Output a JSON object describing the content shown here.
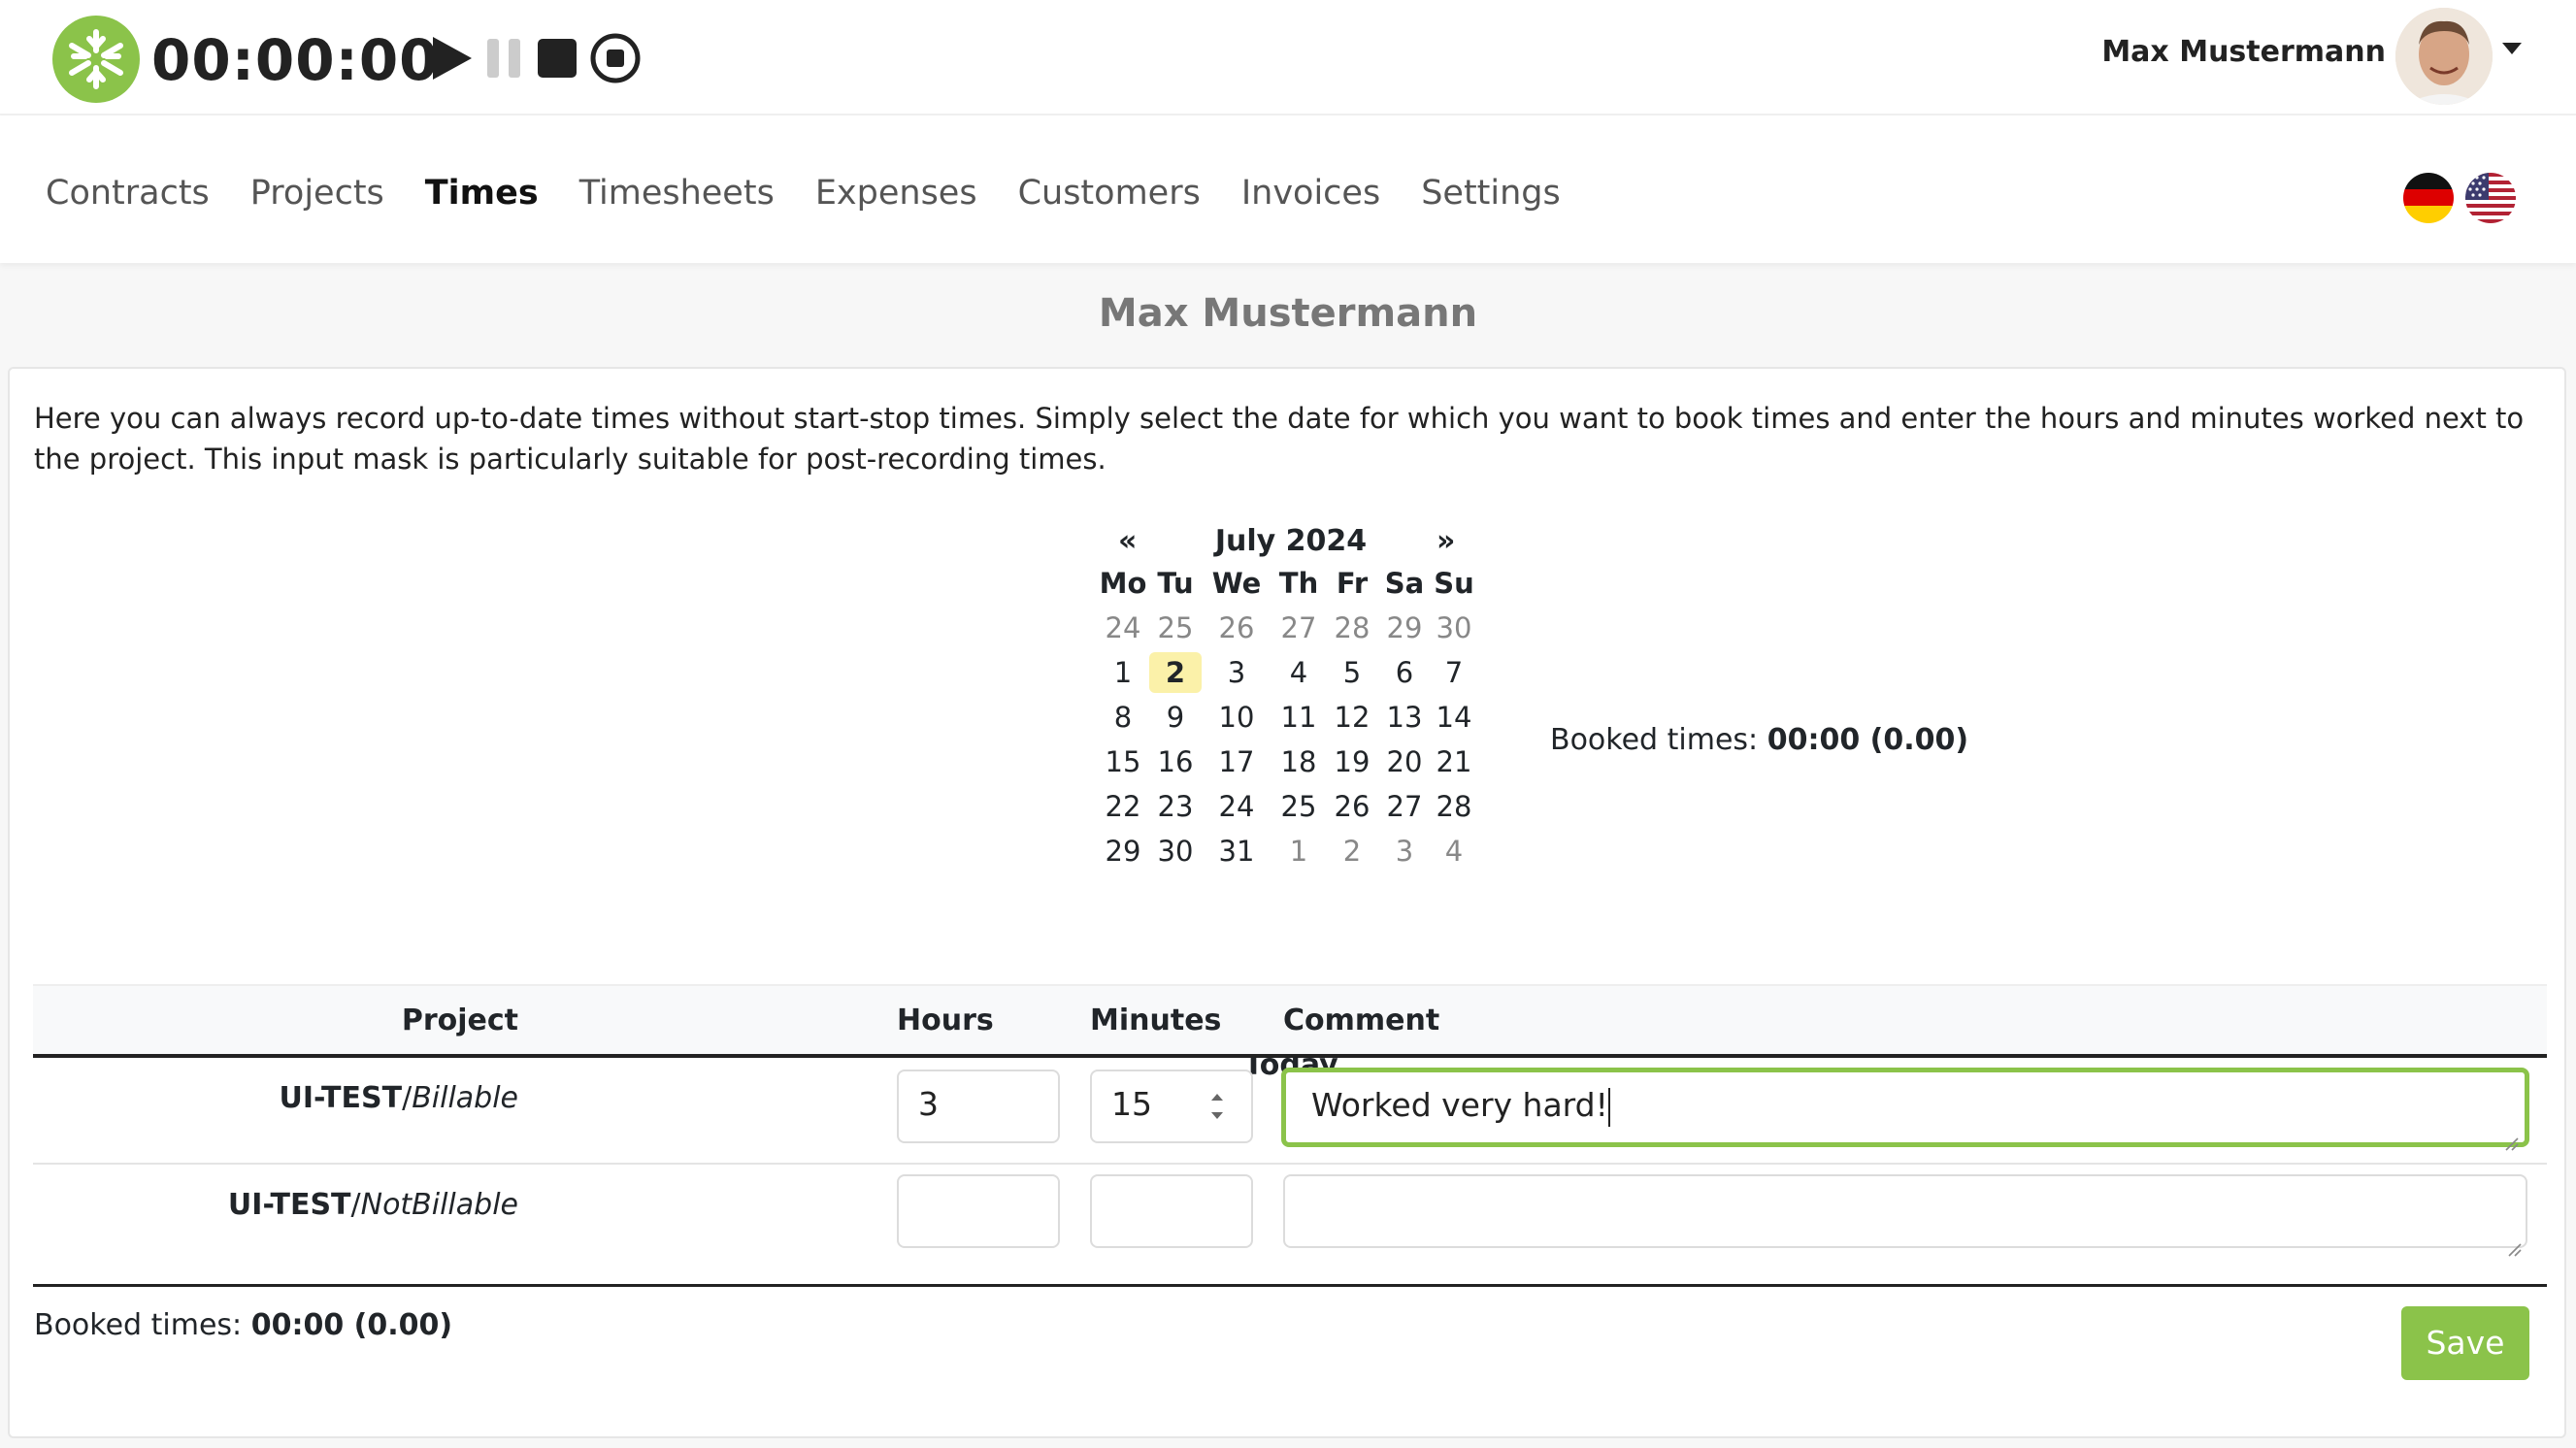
{
  "header": {
    "timer": "00:00:00",
    "user_name": "Max Mustermann",
    "controls": [
      "play-icon",
      "pause-icon",
      "stop-icon",
      "record-stop-icon"
    ]
  },
  "nav": {
    "items": [
      {
        "label": "Contracts"
      },
      {
        "label": "Projects"
      },
      {
        "label": "Times",
        "active": true
      },
      {
        "label": "Timesheets"
      },
      {
        "label": "Expenses"
      },
      {
        "label": "Customers"
      },
      {
        "label": "Invoices"
      },
      {
        "label": "Settings"
      }
    ],
    "languages": [
      "german-flag-icon",
      "us-flag-icon"
    ]
  },
  "page": {
    "title": "Max Mustermann",
    "intro": "Here you can always record up-to-date times without start-stop times. Simply select the date for which you want to book times and enter the hours and minutes worked next to the project. This input mask is particularly suitable for post-recording times."
  },
  "calendar": {
    "prev": "«",
    "next": "»",
    "month": "July 2024",
    "weekdays": [
      "Mo",
      "Tu",
      "We",
      "Th",
      "Fr",
      "Sa",
      "Su"
    ],
    "weeks": [
      [
        "24",
        "25",
        "26",
        "27",
        "28",
        "29",
        "30"
      ],
      [
        "1",
        "2",
        "3",
        "4",
        "5",
        "6",
        "7"
      ],
      [
        "8",
        "9",
        "10",
        "11",
        "12",
        "13",
        "14"
      ],
      [
        "15",
        "16",
        "17",
        "18",
        "19",
        "20",
        "21"
      ],
      [
        "22",
        "23",
        "24",
        "25",
        "26",
        "27",
        "28"
      ],
      [
        "29",
        "30",
        "31",
        "1",
        "2",
        "3",
        "4"
      ]
    ],
    "selected": "2",
    "today_label": "Today"
  },
  "booked": {
    "label": "Booked times:",
    "value": "00:00 (0.00)"
  },
  "table": {
    "headers": {
      "project": "Project",
      "hours": "Hours",
      "minutes": "Minutes",
      "comment": "Comment"
    },
    "rows": [
      {
        "project": "UI-TEST",
        "type": "Billable",
        "hours": "3",
        "minutes": "15",
        "comment": "Worked very hard!"
      },
      {
        "project": "UI-TEST",
        "type": "NotBillable",
        "hours": "",
        "minutes": "",
        "comment": ""
      }
    ]
  },
  "actions": {
    "save_label": "Save"
  },
  "colors": {
    "accent": "#8bc34a",
    "highlight": "#fbf1a9"
  }
}
